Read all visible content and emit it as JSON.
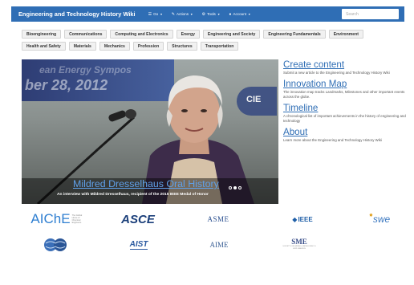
{
  "header": {
    "title": "Engineering and Technology History Wiki",
    "nav": [
      {
        "label": "Go",
        "icon": "list-icon"
      },
      {
        "label": "Actions",
        "icon": "pencil-icon"
      },
      {
        "label": "Tools",
        "icon": "gear-icon"
      },
      {
        "label": "Account",
        "icon": "user-icon"
      }
    ],
    "search_placeholder": "Search",
    "bar_color": "#2f6eb5"
  },
  "categories": {
    "row1": [
      "Bioengineering",
      "Communications",
      "Computing and Electronics",
      "Energy",
      "Engineering and Society",
      "Engineering Fundamentals",
      "Environment"
    ],
    "row2": [
      "Health and Safety",
      "Materials",
      "Mechanics",
      "Profession",
      "Structures",
      "Transportation"
    ]
  },
  "hero": {
    "banner_text": "ean Energy Sympos",
    "date_text": "ber 28, 2012",
    "sign_text": "CIE",
    "title": "Mildred Dresselhaus Oral History",
    "subtitle": "An interview with Mildred Dresselhaus, recipient of the 2015 IEEE Medal of Honor",
    "slide_count": 3,
    "active_slide": 2
  },
  "side": [
    {
      "title": "Create content",
      "desc": "Submit a new article to the Engineering and Technology History Wiki"
    },
    {
      "title": "Innovation Map",
      "desc": "The innovation map tracks Landmarks, Milestones and other important events across the globe."
    },
    {
      "title": "Timeline",
      "desc": "A chronological list of important achievements in the history of engineering and technology"
    },
    {
      "title": "About",
      "desc": "Learn more about the Engineering and Technology History Wiki"
    }
  ],
  "logos": {
    "aiche": "AIChE",
    "aiche_sub": "The Global Home of Chemical Engineers",
    "asce": "ASCE",
    "asme": "ASME",
    "ieee": "IEEE",
    "swe": "swe",
    "aist": "AIST",
    "aime": "AIME",
    "sme": "SME",
    "sme_sub": "SOCIETY FOR MINING, METALLURGY & EXPLORATION"
  }
}
